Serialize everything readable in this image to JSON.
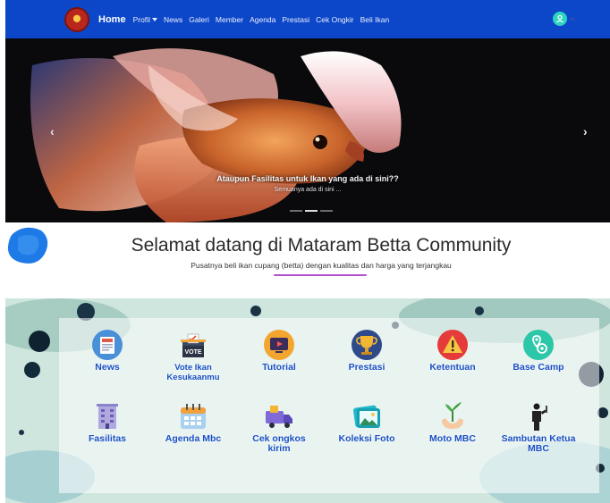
{
  "nav": {
    "home": "Home",
    "items": [
      "Profil",
      "News",
      "Galeri",
      "Member",
      "Agenda",
      "Prestasi",
      "Cek Ongkir",
      "Beli Ikan"
    ]
  },
  "carousel": {
    "caption_title": "Ataupun Fasilitas untuk Ikan yang ada di sini??",
    "caption_sub": "Semuanya ada di sini ...",
    "prev": "‹",
    "next": "›"
  },
  "welcome": {
    "title": "Selamat datang di Mataram Betta Community",
    "subtitle": "Pusatnya beli ikan cupang (betta) dengan kualitas dan harga yang terjangkau"
  },
  "menu": {
    "items": [
      {
        "label": "News",
        "icon": "news-icon"
      },
      {
        "label": "Vote Ikan Kesukaanmu",
        "icon": "vote-icon"
      },
      {
        "label": "Tutorial",
        "icon": "tutorial-icon"
      },
      {
        "label": "Prestasi",
        "icon": "trophy-icon"
      },
      {
        "label": "Ketentuan",
        "icon": "warning-icon"
      },
      {
        "label": "Base Camp",
        "icon": "base-camp-icon"
      },
      {
        "label": "Fasilitas",
        "icon": "building-icon"
      },
      {
        "label": "Agenda Mbc",
        "icon": "calendar-icon"
      },
      {
        "label": "Cek ongkos kirim",
        "icon": "delivery-truck-icon"
      },
      {
        "label": "Koleksi Foto",
        "icon": "photo-icon"
      },
      {
        "label": "Moto MBC",
        "icon": "plant-hand-icon"
      },
      {
        "label": "Sambutan Ketua MBC",
        "icon": "speaker-person-icon"
      }
    ]
  },
  "colors": {
    "navbar": "#0d47c9",
    "menu_label": "#1a4fc4",
    "underline": "#b04fd0"
  }
}
